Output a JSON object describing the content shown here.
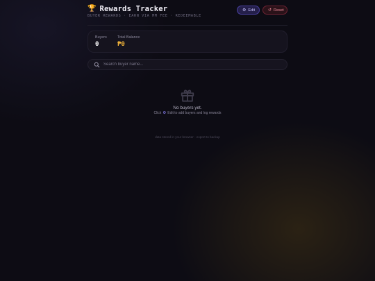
{
  "header": {
    "trophy_icon": "trophy-icon",
    "title": "Rewards Tracker",
    "subtitle": "BUYER REWARDS · EARN VIA MM FEE · REDEEMABLE",
    "edit_button": {
      "icon": "gear-icon",
      "label": "Edit"
    },
    "reset_button": {
      "icon": "reset-icon",
      "label": "Reset"
    }
  },
  "stats": {
    "buyers_label": "Buyers",
    "buyers_value": "0",
    "balance_label": "Total Balance",
    "balance_value": "₱0"
  },
  "search": {
    "placeholder": "Search buyer name...",
    "value": ""
  },
  "empty_state": {
    "icon": "gift-icon",
    "title": "No buyers yet.",
    "hint_prefix": "Click",
    "hint_icon": "gear-icon",
    "hint_suffix": "Edit to add buyers and log rewards"
  },
  "footer": {
    "note": "data stored in your browser · export to backup"
  },
  "colors": {
    "background": "#0d0c14",
    "accent_gold": "#f2b43b",
    "edit_accent": "#8f86ff",
    "reset_accent": "#f08b9a"
  }
}
